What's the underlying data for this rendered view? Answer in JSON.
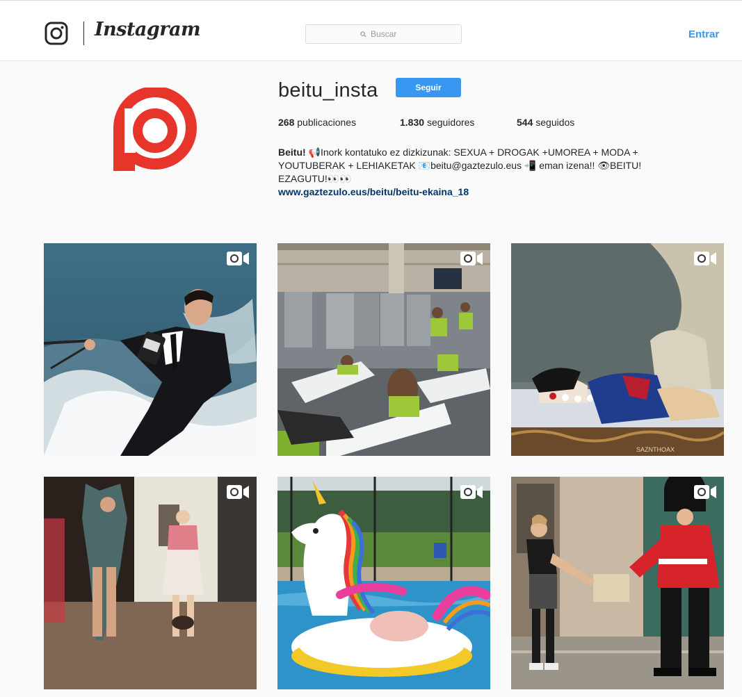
{
  "header": {
    "brand": "Instagram",
    "search_placeholder": "Buscar",
    "login_label": "Entrar"
  },
  "profile": {
    "username": "beitu_insta",
    "follow_label": "Seguir",
    "stats": {
      "posts": "268",
      "posts_label": "publicaciones",
      "followers": "1.830",
      "followers_label": "seguidores",
      "following": "544",
      "following_label": "seguidos"
    },
    "bio": {
      "name": "Beitu!",
      "text_line1": "📢Inork kontatuko ez dizkizunak: SEXUA + DROGAK +UMOREA + MODA +",
      "text_line2": "YOUTUBERAK + LEHIAKETAK 📧beitu@gaztezulo.eus 📲 eman izena!! 👁BEITU!",
      "text_line3": "EZAGUTU!👀👀",
      "link": "www.gaztezulo.eus/beitu/beitu-ekaina_18"
    }
  },
  "colors": {
    "accent": "#3897f0",
    "brand_red": "#e8352b",
    "link": "#003569"
  },
  "posts": [
    {
      "scene": "waterski-suit",
      "has_video": true,
      "watermark": ""
    },
    {
      "scene": "mattress-warehouse",
      "has_video": true,
      "watermark": ""
    },
    {
      "scene": "cartoon-snowwhite",
      "has_video": true,
      "watermark": "SAZNTHOAX"
    },
    {
      "scene": "room-dancers",
      "has_video": true,
      "watermark": ""
    },
    {
      "scene": "unicorn-pool",
      "has_video": true,
      "watermark": ""
    },
    {
      "scene": "royal-guard",
      "has_video": true,
      "watermark": ""
    }
  ]
}
